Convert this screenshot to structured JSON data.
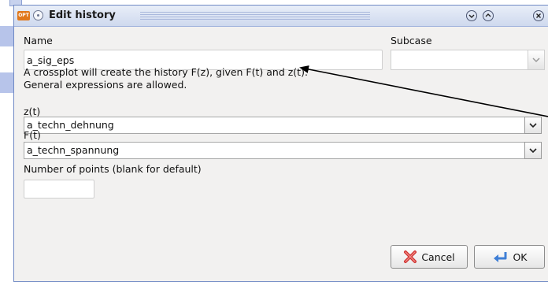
{
  "window": {
    "title": "Edit history",
    "app_icon_text": "OPT"
  },
  "form": {
    "name_label": "Name",
    "name_value": "a_sig_eps",
    "subcase_label": "Subcase",
    "subcase_value": "",
    "description_line1": "A crossplot will create the history F(z), given F(t) and z(t).",
    "description_line2": "General expressions are allowed.",
    "z_label": "z(t)",
    "z_value": "a_techn_dehnung",
    "f_label": "F(t)",
    "f_value": "a_techn_spannung",
    "points_label": "Number of points (blank for default)",
    "points_value": ""
  },
  "buttons": {
    "cancel_label": "Cancel",
    "ok_label": "OK"
  },
  "icons": {
    "cancel": "cancel-x-icon",
    "ok": "ok-arrow-icon",
    "dropdown": "chevron-down-icon"
  },
  "colors": {
    "titlebar": "#cfd9ee",
    "dialog_bg": "#f2f1f0",
    "accent_border": "#6f89c4",
    "cancel_icon": "#d0302f",
    "ok_icon": "#3f7fd6"
  }
}
